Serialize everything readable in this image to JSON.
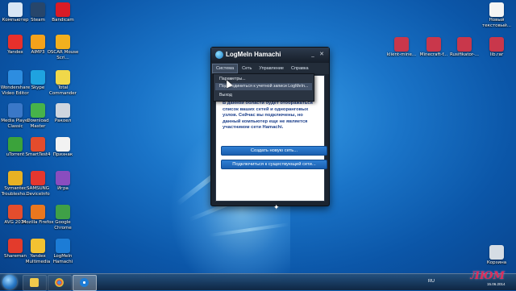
{
  "desktop": {
    "left_icons": [
      {
        "label": "Компьютер",
        "icon": "computer-icon",
        "color": "#d8e6f5"
      },
      {
        "label": "Steam",
        "icon": "steam-icon",
        "color": "#27466b"
      },
      {
        "label": "Bandicam",
        "icon": "bandicam-icon",
        "color": "#d91b26"
      },
      {
        "label": "Yandex",
        "icon": "yandex-icon",
        "color": "#e8302b"
      },
      {
        "label": "AIMP3",
        "icon": "aimp-icon",
        "color": "#f4a21b"
      },
      {
        "label": "OSCAR Mouse Scri...",
        "icon": "oscar-icon",
        "color": "#f2b01e"
      },
      {
        "label": "Wondershare Video Editor",
        "icon": "wondershare-icon",
        "color": "#2d8de0"
      },
      {
        "label": "Skype",
        "icon": "skype-icon",
        "color": "#1fa3e0"
      },
      {
        "label": "Total Commander",
        "icon": "total-commander-icon",
        "color": "#f0d84a"
      },
      {
        "label": "Media Player Classic",
        "icon": "media-player-icon",
        "color": "#3a78c8"
      },
      {
        "label": "Download Master",
        "icon": "download-master-icon",
        "color": "#47b34a"
      },
      {
        "label": "Ракоел",
        "icon": "tool-icon",
        "color": "#cfd6df"
      },
      {
        "label": "uTorrent",
        "icon": "utorrent-icon",
        "color": "#3ba33b"
      },
      {
        "label": "SmartTest4",
        "icon": "smarttest-icon",
        "color": "#e34c2c"
      },
      {
        "label": "Признак",
        "icon": "document-icon",
        "color": "#f2f2f2"
      },
      {
        "label": "Symantec Troublesho...",
        "icon": "symantec-icon",
        "color": "#e8b123"
      },
      {
        "label": "SAMSUNG DeviceInfo",
        "icon": "samsung-icon",
        "color": "#e4372f"
      },
      {
        "label": "Игра",
        "icon": "game-icon",
        "color": "#8a4dbf"
      },
      {
        "label": "AVG 2014",
        "icon": "avg-icon",
        "color": "#e44d2d"
      },
      {
        "label": "Mozilla Firefox",
        "icon": "firefox-icon",
        "color": "#e9771e"
      },
      {
        "label": "Google Chrome",
        "icon": "chrome-icon",
        "color": "#3fa047"
      },
      {
        "label": "Shareman",
        "icon": "shareman-icon",
        "color": "#e33b2c"
      },
      {
        "label": "Yandex Multimedia",
        "icon": "multimedia-icon",
        "color": "#f2c232"
      },
      {
        "label": "LogMeIn Hamachi",
        "icon": "hamachi-icon",
        "color": "#1c7cd6"
      }
    ],
    "right_icons": [
      {
        "label": "Новый текстовый...",
        "icon": "text-file-icon",
        "color": "#f4f4f4"
      },
      {
        "label": "klient-mine...",
        "icon": "archive-icon",
        "color": "#c9374b"
      },
      {
        "label": "Minecraft-f...",
        "icon": "archive-icon",
        "color": "#c9374b"
      },
      {
        "label": "Rusifikator-...",
        "icon": "archive-icon",
        "color": "#c9374b"
      },
      {
        "label": "lib.rar",
        "icon": "archive-icon",
        "color": "#c9374b"
      },
      {
        "label": "Корзина",
        "icon": "recycle-bin-icon",
        "color": "#d6dde4"
      }
    ]
  },
  "hamachi": {
    "title": "LogMeIn Hamachi",
    "menu": [
      "Система",
      "Сеть",
      "Управление",
      "Справка"
    ],
    "dropdown": [
      "Параметры...",
      "Подсоединиться к учетной записи LogMeIn...",
      "Выход"
    ],
    "info_text": "В данной области будет отображаться список ваших сетей и одноранговых узлов. Сейчас вы подключены, но данный компьютер еще не является участником сети Hamachi.",
    "create_button": "Создать новую сеть...",
    "join_button": "Подключиться к существующей сети..."
  },
  "taskbar": {
    "lang": "RU",
    "date": "15.06.2014"
  },
  "watermark": "ЛЮМ"
}
